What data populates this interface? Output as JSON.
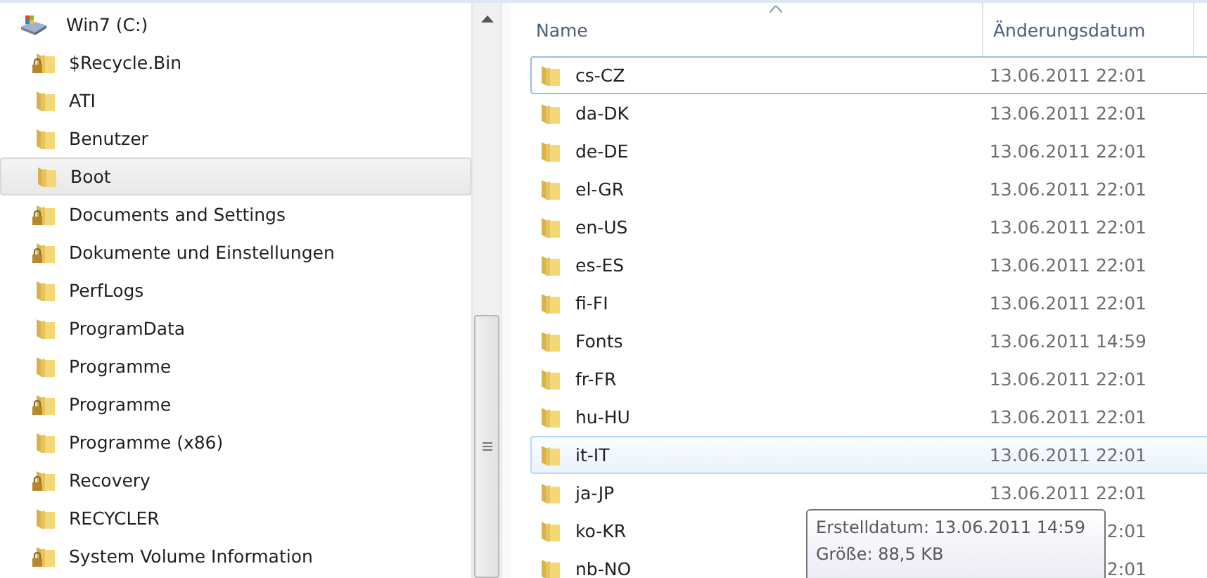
{
  "tree": {
    "label": "Win7 (C:)",
    "children": [
      {
        "label": "$Recycle.Bin",
        "locked": true,
        "selected": false
      },
      {
        "label": "ATI",
        "locked": false,
        "selected": false
      },
      {
        "label": "Benutzer",
        "locked": false,
        "selected": false
      },
      {
        "label": "Boot",
        "locked": false,
        "selected": true
      },
      {
        "label": "Documents and Settings",
        "locked": true,
        "selected": false
      },
      {
        "label": "Dokumente und Einstellungen",
        "locked": true,
        "selected": false
      },
      {
        "label": "PerfLogs",
        "locked": false,
        "selected": false
      },
      {
        "label": "ProgramData",
        "locked": false,
        "selected": false
      },
      {
        "label": "Programme",
        "locked": false,
        "selected": false
      },
      {
        "label": "Programme",
        "locked": true,
        "selected": false
      },
      {
        "label": "Programme (x86)",
        "locked": false,
        "selected": false
      },
      {
        "label": "Recovery",
        "locked": true,
        "selected": false
      },
      {
        "label": "RECYCLER",
        "locked": false,
        "selected": false
      },
      {
        "label": "System Volume Information",
        "locked": true,
        "selected": false
      }
    ]
  },
  "table": {
    "columns": [
      "Name",
      "Änderungsdatum"
    ],
    "rows": [
      {
        "name": "cs-CZ",
        "date": "13.06.2011 22:01",
        "selected": false,
        "focused": true
      },
      {
        "name": "da-DK",
        "date": "13.06.2011 22:01",
        "selected": false,
        "focused": false
      },
      {
        "name": "de-DE",
        "date": "13.06.2011 22:01",
        "selected": false,
        "focused": false
      },
      {
        "name": "el-GR",
        "date": "13.06.2011 22:01",
        "selected": false,
        "focused": false
      },
      {
        "name": "en-US",
        "date": "13.06.2011 22:01",
        "selected": false,
        "focused": false
      },
      {
        "name": "es-ES",
        "date": "13.06.2011 22:01",
        "selected": false,
        "focused": false
      },
      {
        "name": "fi-FI",
        "date": "13.06.2011 22:01",
        "selected": false,
        "focused": false
      },
      {
        "name": "Fonts",
        "date": "13.06.2011 14:59",
        "selected": false,
        "focused": false
      },
      {
        "name": "fr-FR",
        "date": "13.06.2011 22:01",
        "selected": false,
        "focused": false
      },
      {
        "name": "hu-HU",
        "date": "13.06.2011 22:01",
        "selected": false,
        "focused": false
      },
      {
        "name": "it-IT",
        "date": "13.06.2011 22:01",
        "selected": true,
        "focused": false
      },
      {
        "name": "ja-JP",
        "date": "13.06.2011 22:01",
        "selected": false,
        "focused": false
      },
      {
        "name": "ko-KR",
        "date": "2:01",
        "selected": false,
        "focused": false
      },
      {
        "name": "nb-NO",
        "date": "2:01",
        "selected": false,
        "focused": false
      }
    ]
  },
  "tooltip": {
    "lines": [
      "Erstelldatum: 13.06.2011 14:59",
      "Größe: 88,5 KB"
    ]
  }
}
